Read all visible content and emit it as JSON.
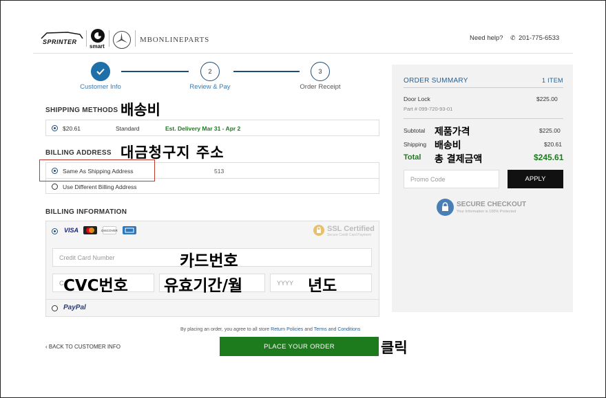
{
  "header": {
    "brand_sprinter": "SPRINTER",
    "brand_smart": "smart",
    "brand_site": "MBONLINEPARTS",
    "help_text": "Need help?",
    "phone": "201-775-6533"
  },
  "steps": [
    {
      "number": "✓",
      "label": "Customer Info",
      "state": "done"
    },
    {
      "number": "2",
      "label": "Review & Pay",
      "state": "active"
    },
    {
      "number": "3",
      "label": "Order Receipt",
      "state": "pending"
    }
  ],
  "shipping": {
    "title": "SHIPPING METHODS",
    "annotation": "배송비",
    "price": "$20.61",
    "method": "Standard",
    "delivery": "Est. Delivery Mar 31 - Apr 2"
  },
  "billing_address": {
    "title": "BILLING ADDRESS",
    "annotation": "대금청구지 주소",
    "option_same": "Same As Shipping Address",
    "option_same_detail": "513",
    "option_different": "Use Different Billing Address"
  },
  "billing_info": {
    "title": "BILLING INFORMATION",
    "cards": [
      "VISA",
      "MC",
      "DISCOVER",
      "AMEX"
    ],
    "ssl_title": "SSL Certified",
    "ssl_sub": "Secure Credit Card Payment",
    "card_number_placeholder": "Credit Card Number",
    "card_number_annotation": "카드번호",
    "cvc_placeholder": "C",
    "cvc_annotation": "CVC번호",
    "expiry_annotation": "유효기간/월",
    "year_placeholder": "YYYY",
    "year_annotation": "년도",
    "paypal": "PayPal"
  },
  "footer": {
    "agree_prefix": "By placing an order, you agree to all store",
    "return_policies": "Return Policies",
    "and": "and",
    "terms": "Terms and Conditions",
    "back_label": "BACK TO CUSTOMER INFO",
    "place_order": "PLACE YOUR ORDER",
    "click_annotation": "클릭"
  },
  "summary": {
    "title": "ORDER SUMMARY",
    "item_count": "1 ITEM",
    "item_name": "Door Lock",
    "item_price": "$225.00",
    "part_no": "Part # 099-720-93-01",
    "subtotal_label": "Subtotal",
    "subtotal_annotation": "제품가격",
    "subtotal_value": "$225.00",
    "shipping_label": "Shipping",
    "shipping_annotation": "배송비",
    "shipping_value": "$20.61",
    "total_label": "Total",
    "total_annotation": "총 결제금액",
    "total_value": "$245.61",
    "promo_placeholder": "Promo Code",
    "apply_label": "APPLY",
    "secure_title": "SECURE CHECKOUT",
    "secure_sub": "Your Information is 100% Protected"
  },
  "colors": {
    "brand_blue": "#1f5e93",
    "green": "#1d7a1d",
    "highlight_red": "#c0392b"
  }
}
